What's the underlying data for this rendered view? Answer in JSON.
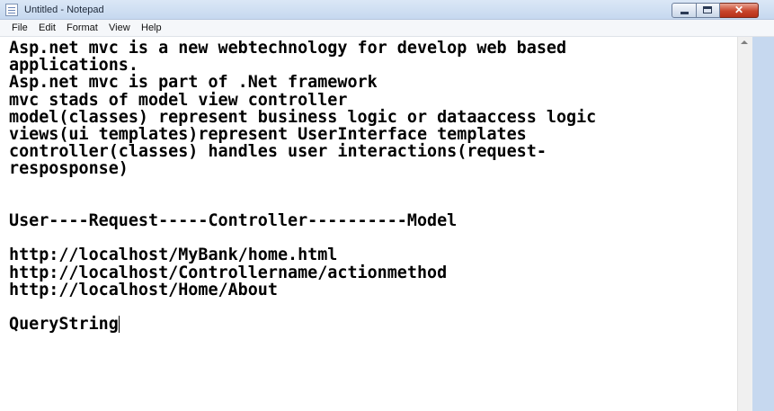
{
  "window": {
    "title": "Untitled - Notepad",
    "close_symbol": "✕"
  },
  "menu": {
    "items": [
      "File",
      "Edit",
      "Format",
      "View",
      "Help"
    ]
  },
  "editor": {
    "lines": [
      "Asp.net mvc is a new webtechnology for develop web based",
      "applications.",
      "Asp.net mvc is part of .Net framework",
      "mvc stads of model view controller",
      "model(classes) represent business logic or dataaccess logic",
      "views(ui templates)represent UserInterface templates",
      "controller(classes) handles user interactions(request-",
      "resposponse)",
      "",
      "",
      "User----Request-----Controller----------Model",
      "",
      "http://localhost/MyBank/home.html",
      "http://localhost/Controllername/actionmethod",
      "http://localhost/Home/About",
      "",
      "QueryString"
    ]
  },
  "icons": {
    "app": "notepad-icon",
    "minimize": "minimize-icon",
    "maximize": "maximize-icon",
    "close": "close-icon",
    "scroll_up": "scroll-up-arrow-icon"
  },
  "colors": {
    "titlebar": "#c6d8ef",
    "close_button": "#c8452c",
    "text": "#000000",
    "background": "#ffffff"
  }
}
